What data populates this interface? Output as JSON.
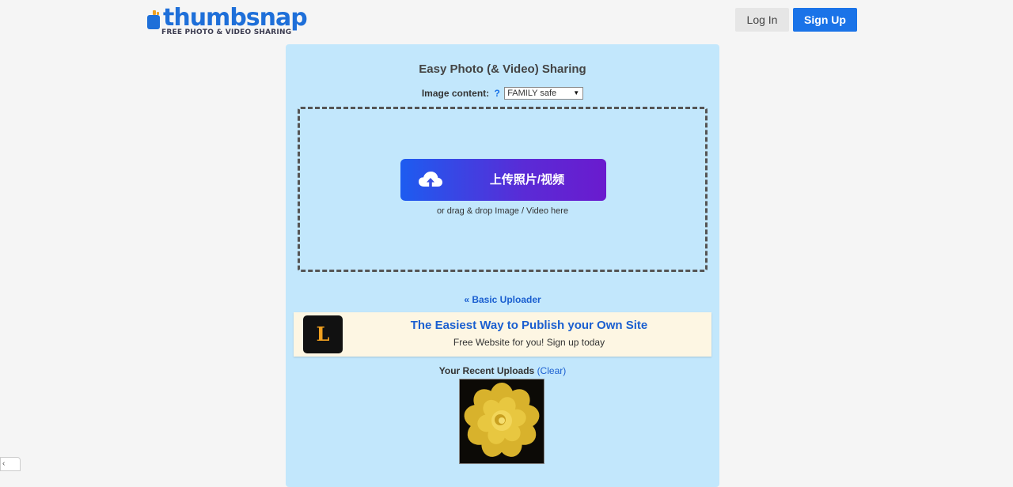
{
  "header": {
    "logo_text": "thumbsnap",
    "logo_tagline": "FREE PHOTO & VIDEO SHARING",
    "login_label": "Log In",
    "signup_label": "Sign Up"
  },
  "upload": {
    "title": "Easy Photo (& Video) Sharing",
    "content_label": "Image content:",
    "help_label": "?",
    "content_select_value": "FAMILY safe",
    "upload_button_label": "上传照片/视频",
    "drag_text": "or drag & drop Image / Video here",
    "basic_uploader_link": "« Basic Uploader"
  },
  "ad": {
    "logo_letter": "L",
    "title": "The Easiest Way to Publish your Own Site",
    "subtitle": "Free Website for you! Sign up today"
  },
  "recent": {
    "label": "Your Recent Uploads",
    "clear_label": "(Clear)"
  },
  "colors": {
    "brand_blue": "#1a73e8",
    "panel_bg": "#c2e7fc",
    "ad_bg": "#fdf6e3"
  },
  "icons": {
    "upload": "cloud-upload-icon",
    "logo": "thumbsnap-logo-icon"
  }
}
